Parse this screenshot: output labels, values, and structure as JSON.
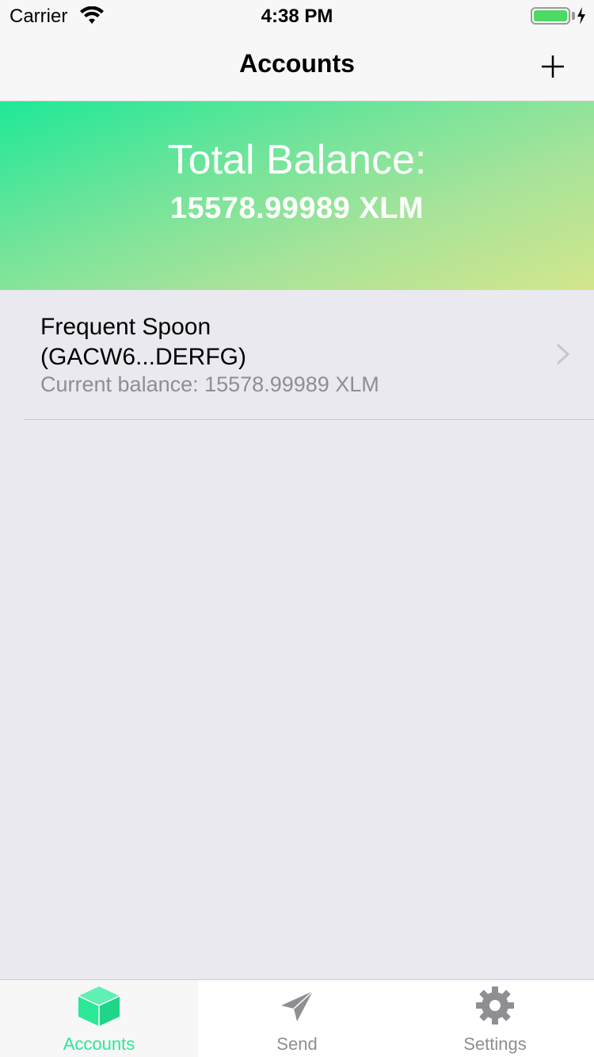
{
  "status_bar": {
    "carrier": "Carrier",
    "time": "4:38 PM",
    "battery_level": 1.0
  },
  "nav": {
    "title": "Accounts",
    "add_icon": "plus-icon"
  },
  "header": {
    "total_label": "Total Balance:",
    "total_amount": "15578.99989 XLM",
    "gradient_colors": [
      "#1fe898",
      "#d3e68c"
    ]
  },
  "accounts": [
    {
      "name": "Frequent Spoon\n(GACW6...DERFG)",
      "balance": "Current balance: 15578.99989 XLM"
    }
  ],
  "tabs": [
    {
      "label": "Accounts",
      "icon": "cube-icon",
      "active": true
    },
    {
      "label": "Send",
      "icon": "paper-plane-icon",
      "active": false
    },
    {
      "label": "Settings",
      "icon": "gear-icon",
      "active": false
    }
  ],
  "colors": {
    "accent": "#2be897",
    "secondary_text": "#8e8e93",
    "background": "#e9e9ef"
  }
}
